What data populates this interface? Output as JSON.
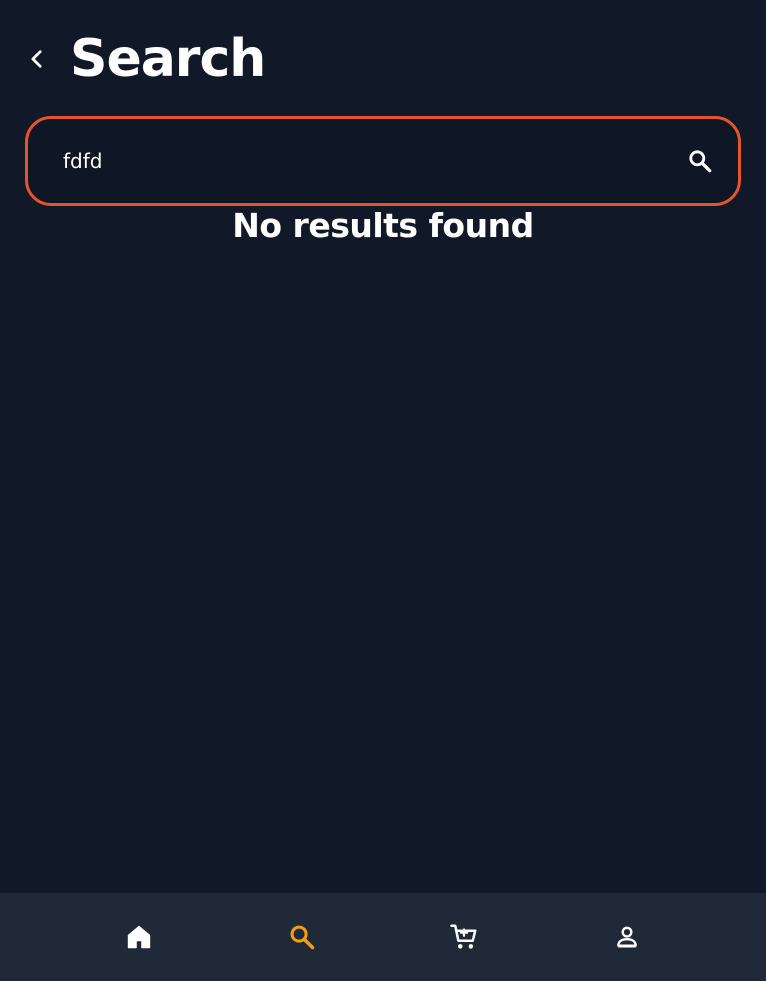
{
  "header": {
    "title": "Search"
  },
  "search": {
    "value": "fdfd",
    "placeholder": ""
  },
  "results": {
    "empty_message": "No results found"
  },
  "colors": {
    "background": "#111827",
    "nav_background": "#1f2937",
    "accent_border": "#e8542a",
    "active_nav": "#f59e0b",
    "text": "#ffffff"
  },
  "nav": {
    "items": [
      {
        "icon": "home-icon",
        "active": false
      },
      {
        "icon": "search-icon",
        "active": true
      },
      {
        "icon": "cart-icon",
        "active": false
      },
      {
        "icon": "profile-icon",
        "active": false
      }
    ]
  }
}
